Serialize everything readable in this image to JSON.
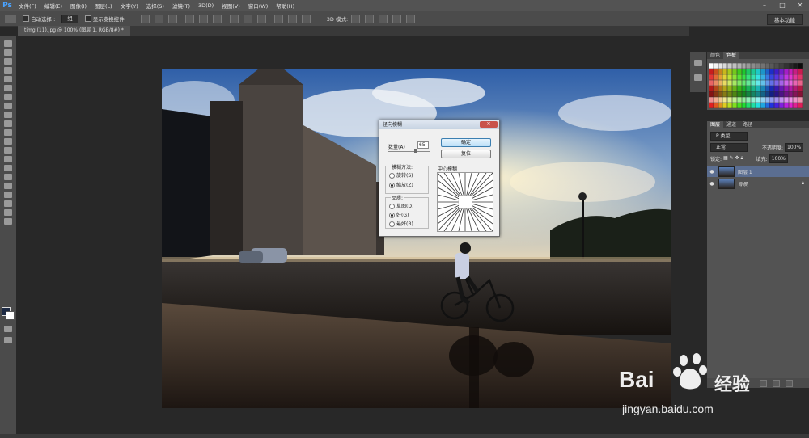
{
  "menubar": {
    "logo": "Ps",
    "items": [
      "文件(F)",
      "编辑(E)",
      "图像(I)",
      "图层(L)",
      "文字(Y)",
      "选择(S)",
      "滤镜(T)",
      "3D(D)",
      "视图(V)",
      "窗口(W)",
      "帮助(H)"
    ]
  },
  "options_bar": {
    "auto_select_label": "自动选择 :",
    "auto_select_value": "组",
    "show_transform_label": "显示变换控件",
    "mode3d_label": "3D 模式:",
    "workspace": "基本功能"
  },
  "document": {
    "tab_title": "timg (11).jpg @ 100% (图层 1, RGB/8#) *"
  },
  "dialog": {
    "title": "径向模糊",
    "amount_label": "数量(A)",
    "amount_value": "65",
    "ok_button": "确定",
    "reset_button": "复位",
    "method_label": "模糊方法:",
    "method_spin": "旋转(S)",
    "method_zoom": "缩放(Z)",
    "quality_label": "品质:",
    "quality_draft": "草图(D)",
    "quality_good": "好(G)",
    "quality_best": "最好(B)",
    "center_label": "中心模糊"
  },
  "swatch_panel": {
    "tabs": [
      "颜色",
      "色板"
    ]
  },
  "layers_panel": {
    "tabs": [
      "图层",
      "通道",
      "路径"
    ],
    "filter_kind": "P 类型",
    "blend_mode": "正常",
    "opacity_label": "不透明度:",
    "opacity_value": "100%",
    "lock_label": "锁定:",
    "fill_label": "填充:",
    "fill_value": "100%",
    "layers": [
      {
        "name": "图层 1",
        "selected": true
      },
      {
        "name": "背景",
        "selected": false
      }
    ]
  },
  "watermark": {
    "brand": "Bai",
    "brand2": "经验",
    "url": "jingyan.baidu.com"
  },
  "colors": {
    "accent": "#4aa3ff",
    "selected_layer": "#5b6e91",
    "fg_color": "#1d2a44"
  }
}
